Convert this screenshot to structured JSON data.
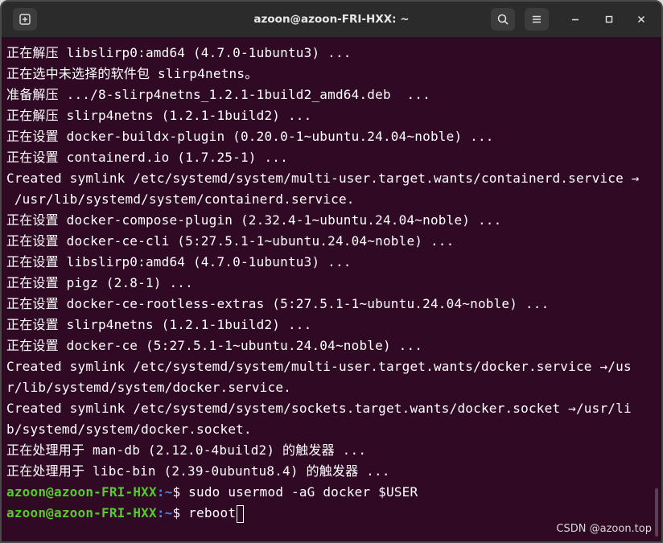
{
  "window": {
    "title": "azoon@azoon-FRI-HXX: ~"
  },
  "icons": {
    "new_tab": "new-tab-icon",
    "search": "search-icon",
    "menu": "hamburger-menu-icon",
    "minimize": "minimize-icon",
    "maximize": "maximize-icon",
    "close": "close-icon"
  },
  "terminal": {
    "lines": [
      "正在解压 libslirp0:amd64 (4.7.0-1ubuntu3) ...",
      "正在选中未选择的软件包 slirp4netns。",
      "准备解压 .../8-slirp4netns_1.2.1-1build2_amd64.deb  ...",
      "正在解压 slirp4netns (1.2.1-1build2) ...",
      "正在设置 docker-buildx-plugin (0.20.0-1~ubuntu.24.04~noble) ...",
      "正在设置 containerd.io (1.7.25-1) ...",
      "Created symlink /etc/systemd/system/multi-user.target.wants/containerd.service →",
      " /usr/lib/systemd/system/containerd.service.",
      "正在设置 docker-compose-plugin (2.32.4-1~ubuntu.24.04~noble) ...",
      "正在设置 docker-ce-cli (5:27.5.1-1~ubuntu.24.04~noble) ...",
      "正在设置 libslirp0:amd64 (4.7.0-1ubuntu3) ...",
      "正在设置 pigz (2.8-1) ...",
      "正在设置 docker-ce-rootless-extras (5:27.5.1-1~ubuntu.24.04~noble) ...",
      "正在设置 slirp4netns (1.2.1-1build2) ...",
      "正在设置 docker-ce (5:27.5.1-1~ubuntu.24.04~noble) ...",
      "Created symlink /etc/systemd/system/multi-user.target.wants/docker.service →/us",
      "r/lib/systemd/system/docker.service.",
      "Created symlink /etc/systemd/system/sockets.target.wants/docker.socket →/usr/li",
      "b/systemd/system/docker.socket.",
      "正在处理用于 man-db (2.12.0-4build2) 的触发器 ...",
      "正在处理用于 libc-bin (2.39-0ubuntu8.4) 的触发器 ..."
    ],
    "prompts": [
      {
        "user": "azoon@azoon-FRI-HXX",
        "path": ":~",
        "symbol": "$ ",
        "command": "sudo usermod -aG docker $USER"
      },
      {
        "user": "azoon@azoon-FRI-HXX",
        "path": ":~",
        "symbol": "$ ",
        "command": "reboot"
      }
    ]
  },
  "watermark": "CSDN @azoon.top",
  "colors": {
    "terminal_bg": "#300a24",
    "titlebar_bg": "#2b2b2b",
    "prompt_user": "#55cc2c",
    "prompt_path": "#4f82d8"
  }
}
